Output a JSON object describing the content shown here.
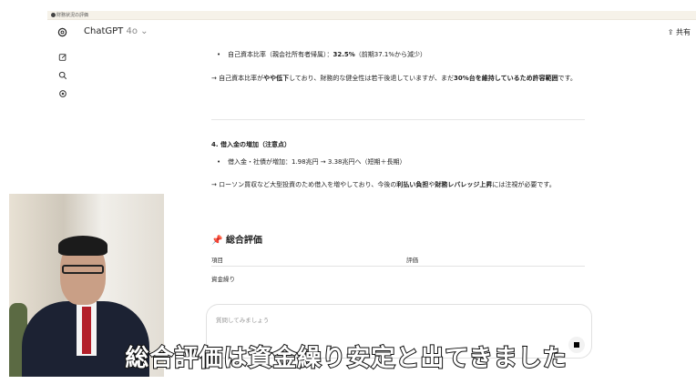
{
  "browser": {
    "tab_title": "財務状況の評価"
  },
  "header": {
    "model_name": "ChatGPT",
    "model_version": "4o",
    "share_label": "共有"
  },
  "conversation": {
    "equity_bullet": {
      "prefix": "自己資本比率（親会社所有者帰属）：",
      "value": "32.5%",
      "suffix": "（前期37.1%から減少）"
    },
    "equity_note": {
      "part1": "→ 自己資本比率が",
      "bold1": "やや低下",
      "part2": "しており、財務的な健全性は若干後退していますが、まだ",
      "bold2": "30%台を維持しているため許容範囲",
      "part3": "です。"
    },
    "section4_title": "4. 借入金の増加（注意点）",
    "debt_bullet": "借入金・社債が増加：1.98兆円 → 3.38兆円へ（短期＋長期）",
    "debt_note": {
      "part1": "→ ローソン買収など大型投資のため借入を増やしており、今後の",
      "bold1": "利払い負担",
      "part2": "や",
      "bold2": "財務レバレッジ上昇",
      "part3": "には注視が必要です。"
    },
    "eval_title": "総合評価",
    "table": {
      "headers": [
        "項目",
        "評価"
      ],
      "rows": [
        [
          "資金繰り",
          ""
        ]
      ]
    }
  },
  "composer": {
    "placeholder": "質問してみましょう"
  },
  "subtitle": "総合評価は資金繰り安定と出てきました",
  "icons": [
    "new-chat-icon",
    "search-icon",
    "gpts-icon",
    "openai-logo-icon",
    "share-icon",
    "pin-icon",
    "stop-icon"
  ]
}
